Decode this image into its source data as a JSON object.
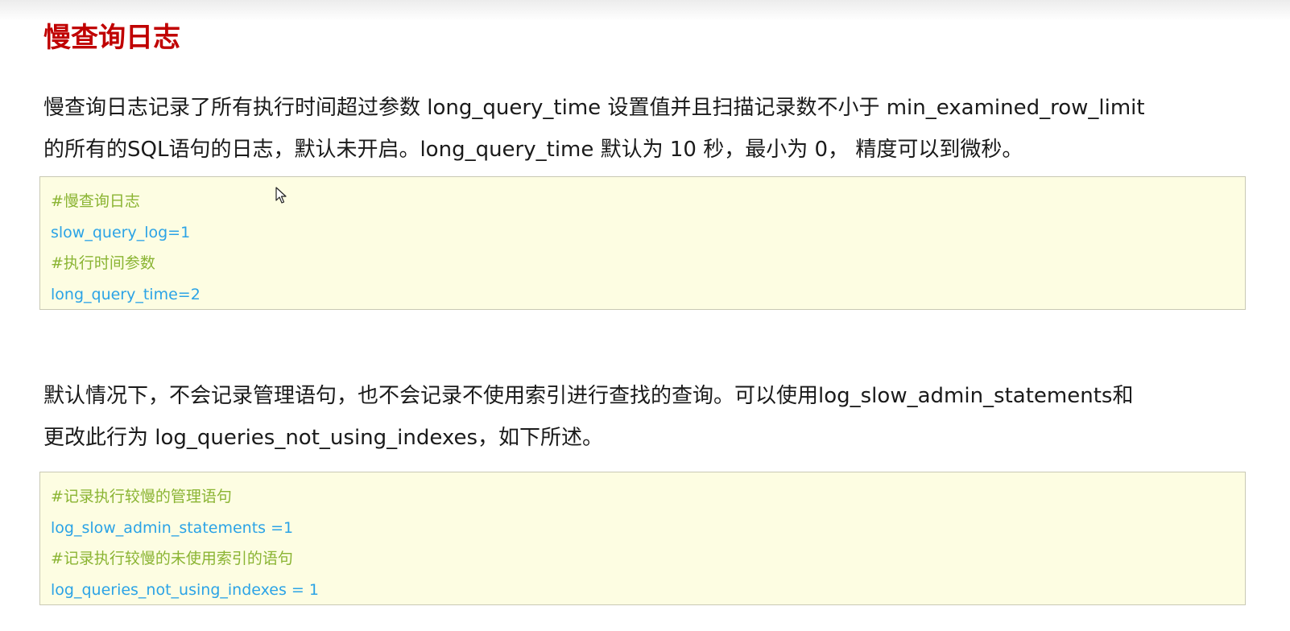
{
  "title": "慢查询日志",
  "paragraph1": {
    "line1": "慢查询日志记录了所有执行时间超过参数 long_query_time 设置值并且扫描记录数不小于 min_examined_row_limit",
    "line2": "的所有的SQL语句的日志，默认未开启。long_query_time 默认为 10 秒，最小为 0， 精度可以到微秒。"
  },
  "code_block1": {
    "lines": [
      "#慢查询日志",
      "slow_query_log=1",
      "#执行时间参数",
      "long_query_time=2"
    ]
  },
  "paragraph2": {
    "line1": "默认情况下，不会记录管理语句，也不会记录不使用索引进行查找的查询。可以使用log_slow_admin_statements和",
    "line2": "更改此行为 log_queries_not_using_indexes，如下所述。"
  },
  "code_block2": {
    "lines": [
      "#记录执行较慢的管理语句",
      "log_slow_admin_statements =1",
      "#记录执行较慢的未使用索引的语句",
      "log_queries_not_using_indexes = 1"
    ]
  },
  "colors": {
    "title": "#c00000",
    "comment": "#8ab432",
    "setting": "#2ba3e6",
    "code_background": "#fdfde2"
  },
  "icons": {
    "cursor": "mouse-pointer-icon"
  }
}
